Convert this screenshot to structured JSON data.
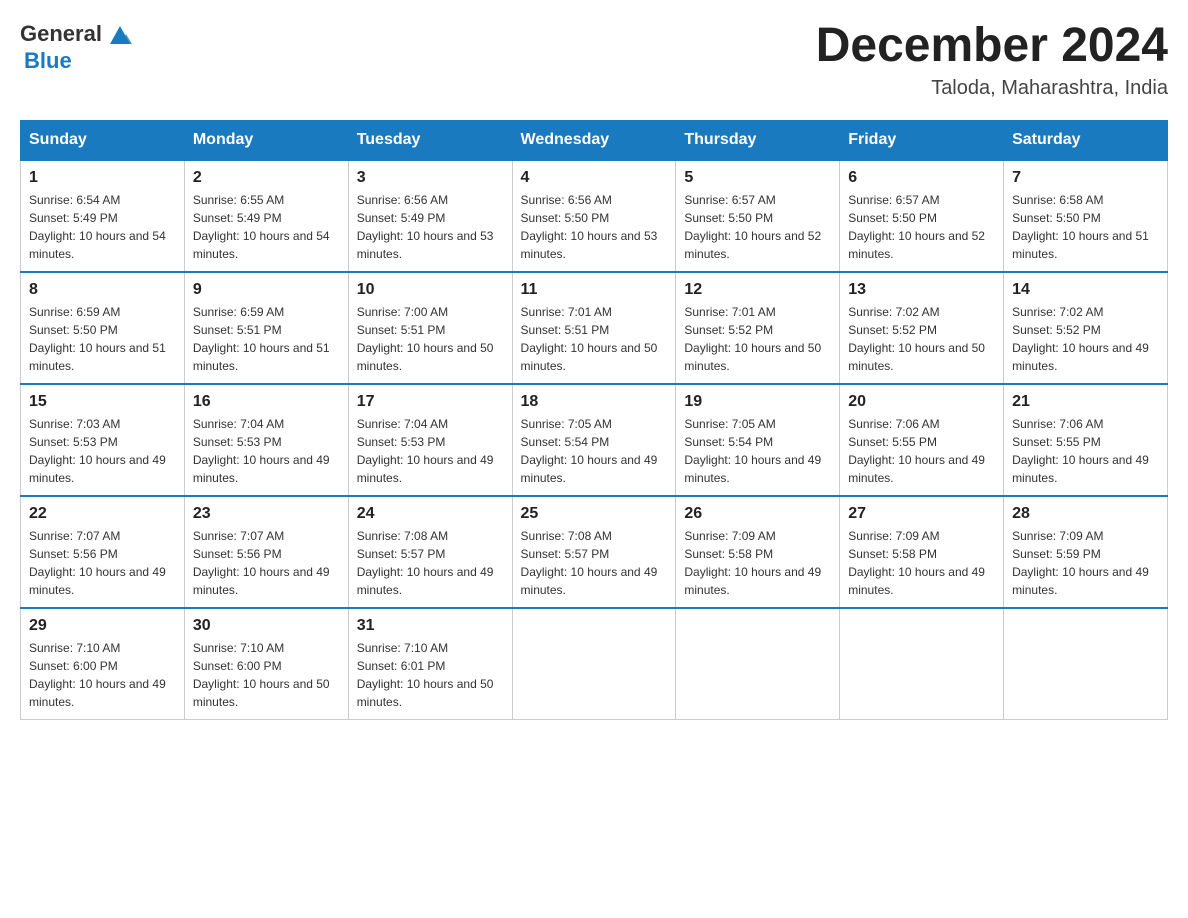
{
  "header": {
    "logo": {
      "general": "General",
      "triangle": "▲",
      "blue": "Blue"
    },
    "title": "December 2024",
    "location": "Taloda, Maharashtra, India"
  },
  "days_of_week": [
    "Sunday",
    "Monday",
    "Tuesday",
    "Wednesday",
    "Thursday",
    "Friday",
    "Saturday"
  ],
  "weeks": [
    [
      {
        "day": "1",
        "sunrise": "6:54 AM",
        "sunset": "5:49 PM",
        "daylight": "10 hours and 54 minutes."
      },
      {
        "day": "2",
        "sunrise": "6:55 AM",
        "sunset": "5:49 PM",
        "daylight": "10 hours and 54 minutes."
      },
      {
        "day": "3",
        "sunrise": "6:56 AM",
        "sunset": "5:49 PM",
        "daylight": "10 hours and 53 minutes."
      },
      {
        "day": "4",
        "sunrise": "6:56 AM",
        "sunset": "5:50 PM",
        "daylight": "10 hours and 53 minutes."
      },
      {
        "day": "5",
        "sunrise": "6:57 AM",
        "sunset": "5:50 PM",
        "daylight": "10 hours and 52 minutes."
      },
      {
        "day": "6",
        "sunrise": "6:57 AM",
        "sunset": "5:50 PM",
        "daylight": "10 hours and 52 minutes."
      },
      {
        "day": "7",
        "sunrise": "6:58 AM",
        "sunset": "5:50 PM",
        "daylight": "10 hours and 51 minutes."
      }
    ],
    [
      {
        "day": "8",
        "sunrise": "6:59 AM",
        "sunset": "5:50 PM",
        "daylight": "10 hours and 51 minutes."
      },
      {
        "day": "9",
        "sunrise": "6:59 AM",
        "sunset": "5:51 PM",
        "daylight": "10 hours and 51 minutes."
      },
      {
        "day": "10",
        "sunrise": "7:00 AM",
        "sunset": "5:51 PM",
        "daylight": "10 hours and 50 minutes."
      },
      {
        "day": "11",
        "sunrise": "7:01 AM",
        "sunset": "5:51 PM",
        "daylight": "10 hours and 50 minutes."
      },
      {
        "day": "12",
        "sunrise": "7:01 AM",
        "sunset": "5:52 PM",
        "daylight": "10 hours and 50 minutes."
      },
      {
        "day": "13",
        "sunrise": "7:02 AM",
        "sunset": "5:52 PM",
        "daylight": "10 hours and 50 minutes."
      },
      {
        "day": "14",
        "sunrise": "7:02 AM",
        "sunset": "5:52 PM",
        "daylight": "10 hours and 49 minutes."
      }
    ],
    [
      {
        "day": "15",
        "sunrise": "7:03 AM",
        "sunset": "5:53 PM",
        "daylight": "10 hours and 49 minutes."
      },
      {
        "day": "16",
        "sunrise": "7:04 AM",
        "sunset": "5:53 PM",
        "daylight": "10 hours and 49 minutes."
      },
      {
        "day": "17",
        "sunrise": "7:04 AM",
        "sunset": "5:53 PM",
        "daylight": "10 hours and 49 minutes."
      },
      {
        "day": "18",
        "sunrise": "7:05 AM",
        "sunset": "5:54 PM",
        "daylight": "10 hours and 49 minutes."
      },
      {
        "day": "19",
        "sunrise": "7:05 AM",
        "sunset": "5:54 PM",
        "daylight": "10 hours and 49 minutes."
      },
      {
        "day": "20",
        "sunrise": "7:06 AM",
        "sunset": "5:55 PM",
        "daylight": "10 hours and 49 minutes."
      },
      {
        "day": "21",
        "sunrise": "7:06 AM",
        "sunset": "5:55 PM",
        "daylight": "10 hours and 49 minutes."
      }
    ],
    [
      {
        "day": "22",
        "sunrise": "7:07 AM",
        "sunset": "5:56 PM",
        "daylight": "10 hours and 49 minutes."
      },
      {
        "day": "23",
        "sunrise": "7:07 AM",
        "sunset": "5:56 PM",
        "daylight": "10 hours and 49 minutes."
      },
      {
        "day": "24",
        "sunrise": "7:08 AM",
        "sunset": "5:57 PM",
        "daylight": "10 hours and 49 minutes."
      },
      {
        "day": "25",
        "sunrise": "7:08 AM",
        "sunset": "5:57 PM",
        "daylight": "10 hours and 49 minutes."
      },
      {
        "day": "26",
        "sunrise": "7:09 AM",
        "sunset": "5:58 PM",
        "daylight": "10 hours and 49 minutes."
      },
      {
        "day": "27",
        "sunrise": "7:09 AM",
        "sunset": "5:58 PM",
        "daylight": "10 hours and 49 minutes."
      },
      {
        "day": "28",
        "sunrise": "7:09 AM",
        "sunset": "5:59 PM",
        "daylight": "10 hours and 49 minutes."
      }
    ],
    [
      {
        "day": "29",
        "sunrise": "7:10 AM",
        "sunset": "6:00 PM",
        "daylight": "10 hours and 49 minutes."
      },
      {
        "day": "30",
        "sunrise": "7:10 AM",
        "sunset": "6:00 PM",
        "daylight": "10 hours and 50 minutes."
      },
      {
        "day": "31",
        "sunrise": "7:10 AM",
        "sunset": "6:01 PM",
        "daylight": "10 hours and 50 minutes."
      },
      null,
      null,
      null,
      null
    ]
  ],
  "labels": {
    "sunrise": "Sunrise:",
    "sunset": "Sunset:",
    "daylight": "Daylight:"
  }
}
